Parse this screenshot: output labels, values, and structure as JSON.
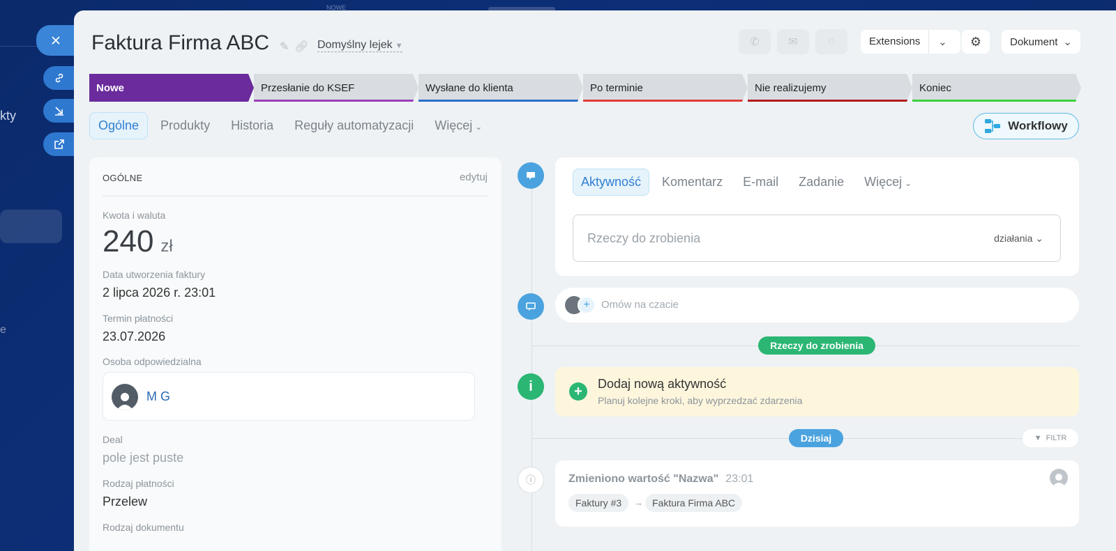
{
  "background": {
    "left_text_1": "kty",
    "left_text_2": "e",
    "top_text": "NOWE"
  },
  "side_buttons": {
    "close_icon": "close-icon",
    "link_icon": "link-icon",
    "download_icon": "arrow-down-icon",
    "open_icon": "external-link-icon"
  },
  "header": {
    "title": "Faktura Firma ABC",
    "funnel": "Domyślny lejek",
    "extensions": "Extensions",
    "document": "Dokument"
  },
  "stages": [
    {
      "label": "Nowe",
      "color": "#6b2b9c"
    },
    {
      "label": "Przesłanie do KSEF",
      "color": "#9b3fb8"
    },
    {
      "label": "Wysłane do klienta",
      "color": "#2a6fc8"
    },
    {
      "label": "Po terminie",
      "color": "#e03b3b"
    },
    {
      "label": "Nie realizujemy",
      "color": "#b01c1c"
    },
    {
      "label": "Koniec",
      "color": "#3bd13b"
    }
  ],
  "tabs": [
    {
      "label": "Ogólne"
    },
    {
      "label": "Produkty"
    },
    {
      "label": "Historia"
    },
    {
      "label": "Reguły automatyzacji"
    },
    {
      "label": "Więcej"
    }
  ],
  "workflowy": "Workflowy",
  "general": {
    "header": "OGÓLNE",
    "edit": "edytuj",
    "amount_label": "Kwota i waluta",
    "amount": "240",
    "currency": "zł",
    "created_label": "Data utworzenia faktury",
    "created": "2 lipca 2026 r. 23:01",
    "due_label": "Termin płatności",
    "due": "23.07.2026",
    "responsible_label": "Osoba odpowiedzialna",
    "responsible": "M G",
    "deal_label": "Deal",
    "deal": "pole jest puste",
    "payment_label": "Rodzaj płatności",
    "payment": "Przelew",
    "doc_type_label": "Rodzaj dokumentu"
  },
  "activity": {
    "tabs": [
      "Aktywność",
      "Komentarz",
      "E-mail",
      "Zadanie",
      "Więcej"
    ],
    "placeholder": "Rzeczy do zrobienia",
    "actions": "działania"
  },
  "chat": {
    "placeholder": "Omów na czacie"
  },
  "todo_pill": "Rzeczy do zrobienia",
  "add_activity": {
    "title": "Dodaj nową aktywność",
    "subtitle": "Planuj kolejne kroki, aby wyprzedzać zdarzenia"
  },
  "today_pill": "Dzisiaj",
  "filter": "FILTR",
  "history": {
    "title": "Zmieniono wartość \"Nazwa\"",
    "time": "23:01",
    "from": "Faktury #3",
    "to": "Faktura Firma ABC"
  }
}
